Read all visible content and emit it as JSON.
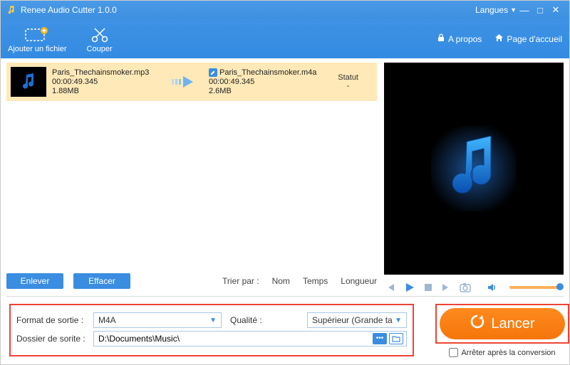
{
  "titlebar": {
    "title": "Renee Audio Cutter 1.0.0",
    "lang": "Langues"
  },
  "toolbar": {
    "add": "Ajouter un fichier",
    "cut": "Couper",
    "about": "A propos",
    "home": "Page d'accueil"
  },
  "file": {
    "src_name": "Paris_Thechainsmoker.mp3",
    "src_dur": "00:00:49.345",
    "src_size": "1.88MB",
    "out_name": "Paris_Thechainsmoker.m4a",
    "out_dur": "00:00:49.345",
    "out_size": "2.6MB",
    "status_hdr": "Statut",
    "status_val": "-"
  },
  "actions": {
    "remove": "Enlever",
    "clear": "Effacer",
    "sort_label": "Trier par :",
    "sort_name": "Nom",
    "sort_time": "Temps",
    "sort_len": "Longueur"
  },
  "settings": {
    "format_label": "Format de sortie :",
    "format_value": "M4A",
    "quality_label": "Qualité :",
    "quality_value": "Supérieur (Grande ta",
    "folder_label": "Dossier de sorite :",
    "folder_value": "D:\\Documents\\Music\\"
  },
  "launch": {
    "label": "Lancer",
    "stop_after": "Arrêter après la conversion"
  }
}
